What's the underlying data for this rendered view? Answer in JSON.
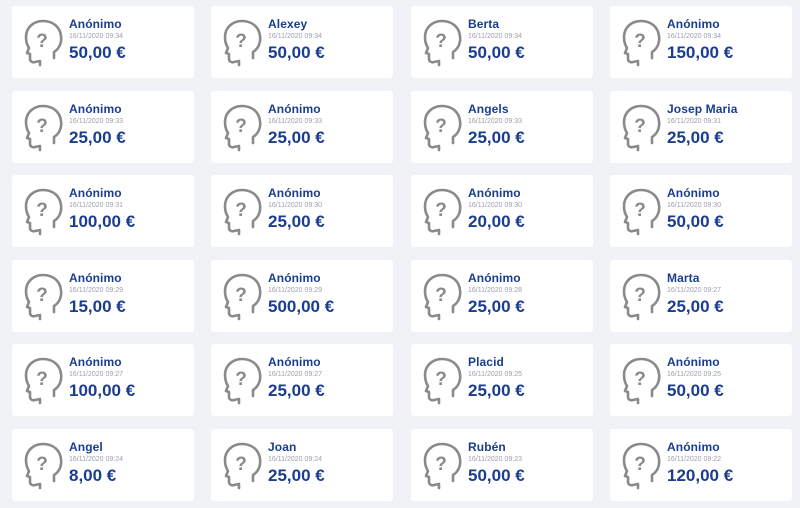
{
  "colors": {
    "background": "#f1f2f5",
    "card": "#ffffff",
    "accent": "#1a3d8f",
    "muted": "#9aa0aa",
    "avatar_stroke": "#8a8a8a"
  },
  "avatar_icon": "unknown-person-question-icon",
  "donations": [
    {
      "name": "Anónimo",
      "date": "16/11/2020 09:34",
      "amount": "50,00 €"
    },
    {
      "name": "Alexey",
      "date": "16/11/2020 09:34",
      "amount": "50,00 €"
    },
    {
      "name": "Berta",
      "date": "16/11/2020 09:34",
      "amount": "50,00 €"
    },
    {
      "name": "Anónimo",
      "date": "16/11/2020 09:34",
      "amount": "150,00 €"
    },
    {
      "name": "Anónimo",
      "date": "16/11/2020 09:33",
      "amount": "25,00 €"
    },
    {
      "name": "Anónimo",
      "date": "16/11/2020 09:33",
      "amount": "25,00 €"
    },
    {
      "name": "Angels",
      "date": "16/11/2020 09:33",
      "amount": "25,00 €"
    },
    {
      "name": "Josep Maria",
      "date": "16/11/2020 09:31",
      "amount": "25,00 €"
    },
    {
      "name": "Anónimo",
      "date": "16/11/2020 09:31",
      "amount": "100,00 €"
    },
    {
      "name": "Anónimo",
      "date": "16/11/2020 09:30",
      "amount": "25,00 €"
    },
    {
      "name": "Anónimo",
      "date": "16/11/2020 09:30",
      "amount": "20,00 €"
    },
    {
      "name": "Anónimo",
      "date": "16/11/2020 09:30",
      "amount": "50,00 €"
    },
    {
      "name": "Anónimo",
      "date": "16/11/2020 09:29",
      "amount": "15,00 €"
    },
    {
      "name": "Anónimo",
      "date": "16/11/2020 09:29",
      "amount": "500,00 €"
    },
    {
      "name": "Anónimo",
      "date": "16/11/2020 09:28",
      "amount": "25,00 €"
    },
    {
      "name": "Marta",
      "date": "16/11/2020 09:27",
      "amount": "25,00 €"
    },
    {
      "name": "Anónimo",
      "date": "16/11/2020 09:27",
      "amount": "100,00 €"
    },
    {
      "name": "Anónimo",
      "date": "16/11/2020 09:27",
      "amount": "25,00 €"
    },
    {
      "name": "Placid",
      "date": "16/11/2020 09:25",
      "amount": "25,00 €"
    },
    {
      "name": "Anónimo",
      "date": "16/11/2020 09:25",
      "amount": "50,00 €"
    },
    {
      "name": "Angel",
      "date": "16/11/2020 09:24",
      "amount": "8,00 €"
    },
    {
      "name": "Joan",
      "date": "16/11/2020 09:24",
      "amount": "25,00 €"
    },
    {
      "name": "Rubén",
      "date": "16/11/2020 09:23",
      "amount": "50,00 €"
    },
    {
      "name": "Anónimo",
      "date": "16/11/2020 09:22",
      "amount": "120,00 €"
    }
  ]
}
